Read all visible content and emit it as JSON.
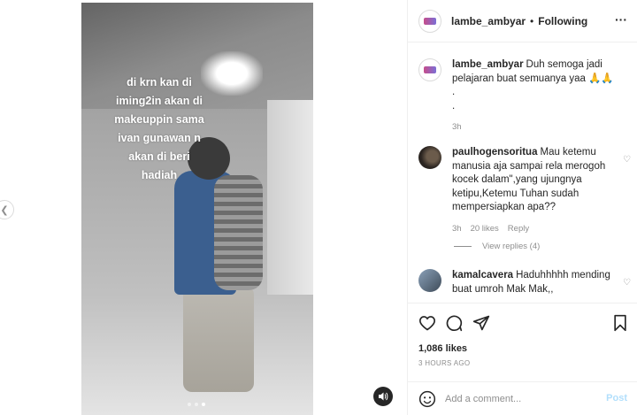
{
  "video": {
    "caption_lines": [
      "di krn kan di",
      "iming2in akan di",
      "makeuppin sama",
      "ivan gunawan n",
      "akan di beri",
      "hadiah"
    ]
  },
  "header": {
    "username": "lambe_ambyar",
    "separator": "•",
    "follow_label": "Following",
    "more_icon": "more-options-icon",
    "more_glyph": "···"
  },
  "caption": {
    "username": "lambe_ambyar",
    "text": "Duh semoga jadi pelajaran buat semuanya yaa 🙏🙏",
    "line2": ".",
    "line3": ".",
    "time": "3h"
  },
  "comments": [
    {
      "username": "paulhogensoritua",
      "text": "Mau ketemu manusia aja sampai rela merogoh kocek dalam\",yang ujungnya ketipu,Ketemu Tuhan sudah mempersiapkan apa??",
      "time": "3h",
      "likes": "20 likes",
      "reply_label": "Reply",
      "view_replies": "View replies (4)"
    },
    {
      "username": "kamalcavera",
      "text": "Haduhhhhh mending buat umroh Mak Mak,,"
    }
  ],
  "likes": "1,086 likes",
  "timestamp": "3 HOURS AGO",
  "add_comment": {
    "placeholder": "Add a comment...",
    "post_label": "Post"
  },
  "colors": {
    "text": "#262626",
    "secondary": "#8e8e8e",
    "post_button": "#b2dffc",
    "border": "#efefef"
  }
}
